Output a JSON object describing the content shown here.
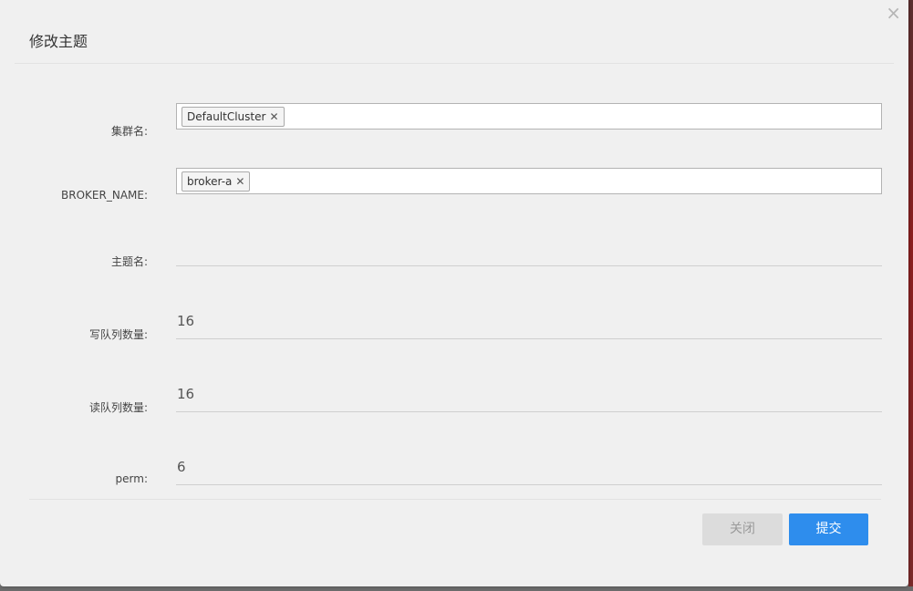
{
  "dialog": {
    "title": "修改主题",
    "close_symbol": "×"
  },
  "form": {
    "cluster_label": "集群名:",
    "cluster_tags": [
      "DefaultCluster"
    ],
    "broker_label": "BROKER_NAME:",
    "broker_tags": [
      "broker-a"
    ],
    "topic_label": "主题名:",
    "topic_value": "",
    "write_queue_label": "写队列数量:",
    "write_queue_value": "16",
    "read_queue_label": "读队列数量:",
    "read_queue_value": "16",
    "perm_label": "perm:",
    "perm_value": "6",
    "tag_remove_symbol": "✕"
  },
  "footer": {
    "close_label": "关闭",
    "submit_label": "提交"
  },
  "colors": {
    "primary": "#2e8ded",
    "disabled_button": "#dcdcdc"
  }
}
